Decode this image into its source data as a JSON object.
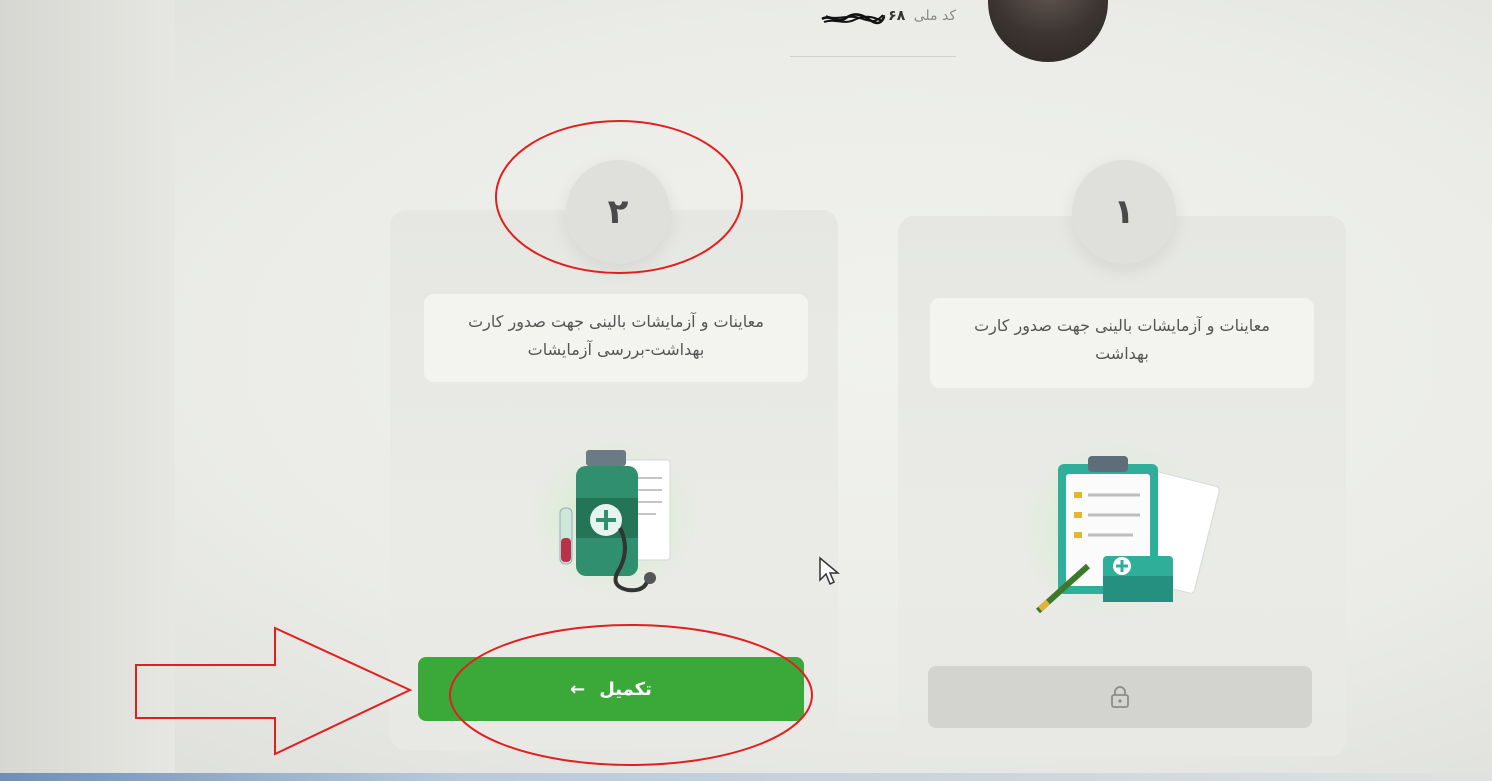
{
  "header": {
    "national_id_label": "کد ملی",
    "national_id_value": "۰۶۸"
  },
  "steps": [
    {
      "number": "۱",
      "description": "معاینات و آزمایشات بالینی جهت صدور کارت بهداشت",
      "illustration_icon": "clipboard-checklist-icon",
      "button_state": "locked",
      "button_icon": "lock-icon"
    },
    {
      "number": "۲",
      "description": "معاینات و آزمایشات بالینی جهت صدور کارت بهداشت-بررسی آزمایشات",
      "illustration_icon": "medical-tests-icon",
      "button_label": "تکمیل",
      "button_icon": "arrow-left-icon",
      "button_state": "active"
    }
  ],
  "colors": {
    "primary_button": "#3aa93a",
    "locked_button": "#d3d4d0",
    "annotation": "#e02020"
  }
}
